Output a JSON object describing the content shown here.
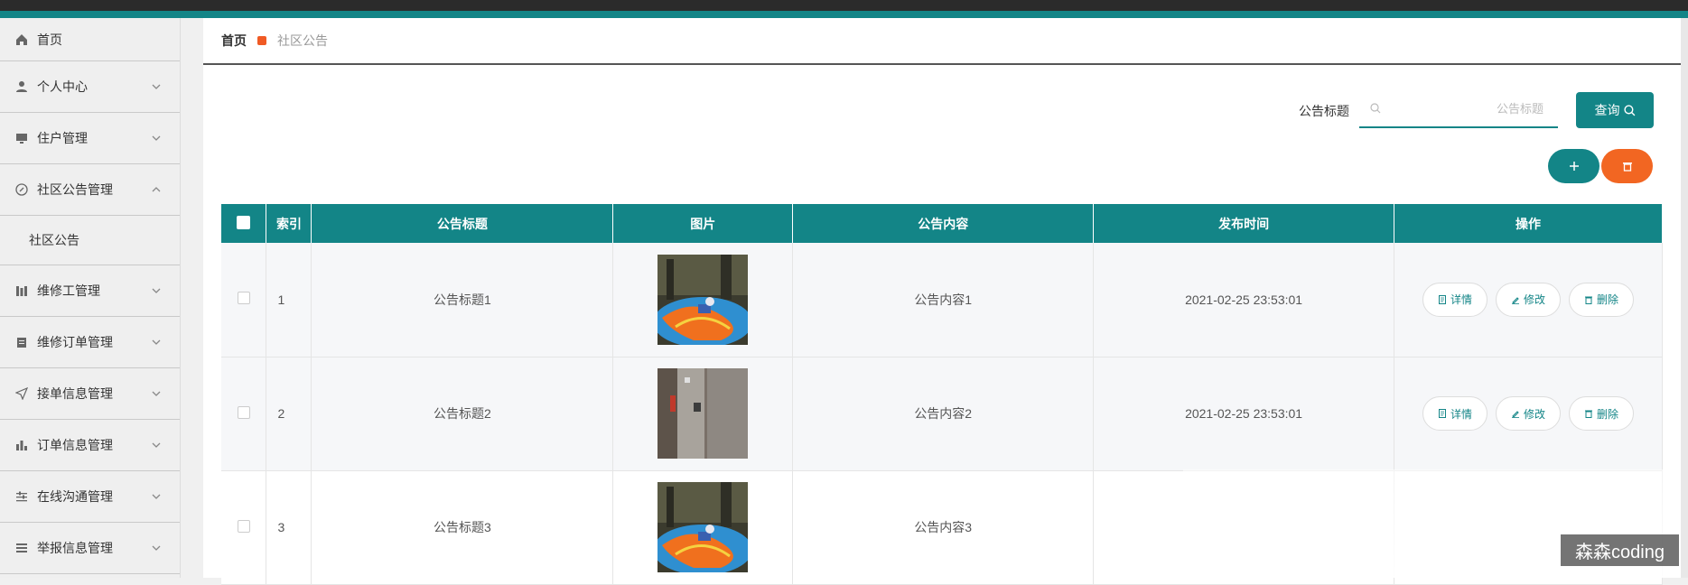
{
  "sidebar": {
    "items": [
      {
        "label": "首页",
        "icon": "home-icon"
      },
      {
        "label": "个人中心",
        "icon": "user-icon"
      },
      {
        "label": "住户管理",
        "icon": "monitor-icon"
      },
      {
        "label": "社区公告管理",
        "icon": "compass-icon"
      },
      {
        "label": "维修工管理",
        "icon": "columns-icon"
      },
      {
        "label": "维修订单管理",
        "icon": "clipboard-icon"
      },
      {
        "label": "接单信息管理",
        "icon": "send-icon"
      },
      {
        "label": "订单信息管理",
        "icon": "bar-chart-icon"
      },
      {
        "label": "在线沟通管理",
        "icon": "sliders-icon"
      },
      {
        "label": "举报信息管理",
        "icon": "list-icon"
      }
    ],
    "sub_item": "社区公告"
  },
  "breadcrumb": {
    "home": "首页",
    "current": "社区公告"
  },
  "search": {
    "label": "公告标题",
    "placeholder": "公告标题",
    "button": "查询"
  },
  "table": {
    "headers": [
      "索引",
      "公告标题",
      "图片",
      "公告内容",
      "发布时间",
      "操作"
    ],
    "rows": [
      {
        "index": "1",
        "title": "公告标题1",
        "image": "playground-image",
        "content": "公告内容1",
        "time": "2021-02-25 23:53:01"
      },
      {
        "index": "2",
        "title": "公告标题2",
        "image": "elevator-image",
        "content": "公告内容2",
        "time": "2021-02-25 23:53:01"
      },
      {
        "index": "3",
        "title": "公告标题3",
        "image": "playground-image",
        "content": "公告内容3",
        "time": ""
      }
    ],
    "actions": {
      "detail": "详情",
      "edit": "修改",
      "delete": "删除"
    }
  },
  "watermark": "森森coding",
  "colors": {
    "primary": "#138587",
    "danger": "#f26622",
    "sidebar_bg": "#efefef"
  }
}
